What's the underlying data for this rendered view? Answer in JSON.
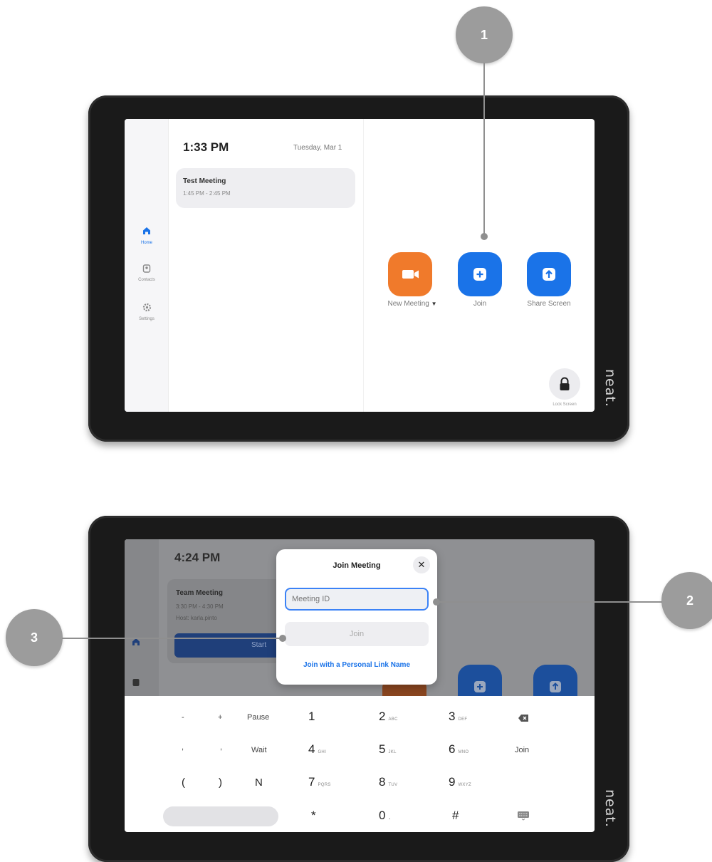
{
  "callouts": {
    "c1": "1",
    "c2": "2",
    "c3": "3"
  },
  "brand": "neat.",
  "home_screen": {
    "sidebar": {
      "items": [
        {
          "label": "Home",
          "icon": "home-icon",
          "active": true
        },
        {
          "label": "Contacts",
          "icon": "contacts-icon",
          "active": false
        },
        {
          "label": "Settings",
          "icon": "gear-icon",
          "active": false
        }
      ]
    },
    "time": "1:33 PM",
    "date": "Tuesday, Mar 1",
    "meeting": {
      "title": "Test Meeting",
      "time": "1:45 PM - 2:45 PM"
    },
    "actions": {
      "new_meeting": {
        "label": "New Meeting",
        "icon": "video-camera-icon",
        "color": "#f07a2b"
      },
      "join": {
        "label": "Join",
        "icon": "plus-icon",
        "color": "#1a73e8"
      },
      "share_screen": {
        "label": "Share Screen",
        "icon": "upload-arrow-icon",
        "color": "#1a73e8"
      }
    },
    "lock_screen": {
      "label": "Lock Screen",
      "icon": "lock-icon"
    }
  },
  "join_screen": {
    "time": "4:24 PM",
    "meeting": {
      "title": "Team Meeting",
      "time": "3:30 PM - 4:30 PM",
      "host": "Host: karla.pinto",
      "start_label": "Start"
    },
    "dialog": {
      "title": "Join Meeting",
      "input_placeholder": "Meeting ID",
      "join_label": "Join",
      "personal_link_label": "Join with a Personal Link Name"
    },
    "keypad": {
      "row1": {
        "minus": "-",
        "plus": "+",
        "pause": "Pause",
        "k1": "1",
        "k2": "2",
        "k2sub": "ABC",
        "k3": "3",
        "k3sub": "DEF"
      },
      "row2": {
        "a": ",",
        "b": ",",
        "wait": "Wait",
        "k4": "4",
        "k4sub": "GHI",
        "k5": "5",
        "k5sub": "JKL",
        "k6": "6",
        "k6sub": "MNO",
        "join": "Join"
      },
      "row3": {
        "lp": "(",
        "rp": ")",
        "n": "N",
        "k7": "7",
        "k7sub": "PQRS",
        "k8": "8",
        "k8sub": "TUV",
        "k9": "9",
        "k9sub": "WXYZ"
      },
      "row4": {
        "star": "*",
        "k0": "0",
        "k0sub": ".",
        "hash": "#"
      }
    }
  }
}
